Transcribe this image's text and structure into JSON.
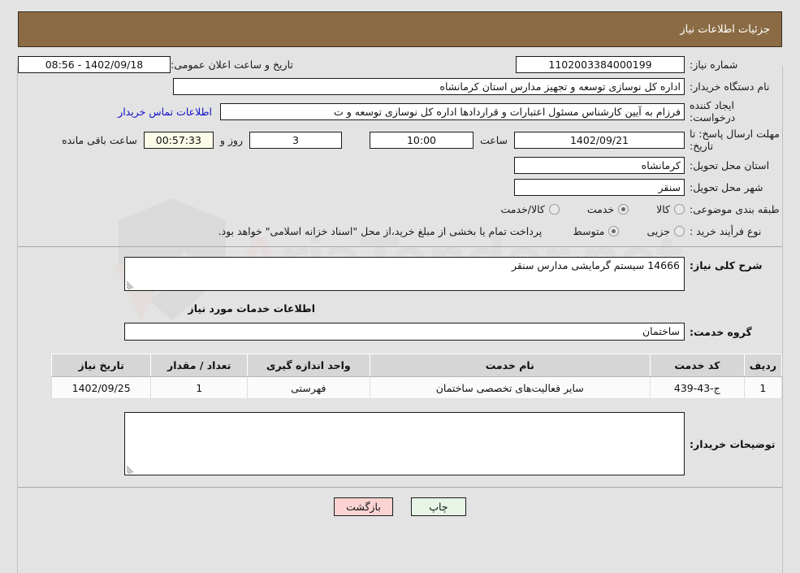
{
  "header": {
    "title": "جزئیات اطلاعات نیاز"
  },
  "form": {
    "need_number": {
      "label": "شماره نیاز:",
      "value": "1102003384000199"
    },
    "public_announce": {
      "label": "تاریخ و ساعت اعلان عمومی:",
      "value": "1402/09/18 - 08:56"
    },
    "buyer_org": {
      "label": "نام دستگاه خریدار:",
      "value": "اداره کل نوسازی  توسعه و تجهیز مدارس استان کرمانشاه"
    },
    "request_creator": {
      "label": "ایجاد کننده درخواست:",
      "value": "فرزام به آیین کارشناس مسئول اعتبارات و قراردادها اداره کل نوسازی  توسعه و ت",
      "contact_link": "اطلاعات تماس خریدار"
    },
    "deadline": {
      "label": "مهلت ارسال پاسخ: تا تاریخ:",
      "date": "1402/09/21",
      "hour_label": "ساعت",
      "hour": "10:00",
      "days": "3",
      "days_label": "روز و",
      "timer": "00:57:33",
      "remaining_label": "ساعت باقی مانده"
    },
    "delivery_province": {
      "label": "استان محل تحویل:",
      "value": "کرمانشاه"
    },
    "delivery_city": {
      "label": "شهر محل تحویل:",
      "value": "سنقر"
    },
    "category": {
      "label": "طبقه بندی موضوعی:",
      "options": [
        {
          "label": "کالا",
          "selected": false
        },
        {
          "label": "خدمت",
          "selected": true
        },
        {
          "label": "کالا/خدمت",
          "selected": false
        }
      ]
    },
    "purchase_type": {
      "label": "نوع فرأیند خرید :",
      "options": [
        {
          "label": "جزیی",
          "selected": false
        },
        {
          "label": "متوسط",
          "selected": true
        }
      ],
      "note": "پرداخت تمام یا بخشی از مبلغ خرید،از محل \"اسناد خزانه اسلامی\" خواهد بود."
    }
  },
  "description": {
    "label": "شرح کلی نیاز:",
    "value": "14666 سیستم گرمایشی مدارس سنقر"
  },
  "services": {
    "section_title": "اطلاعات خدمات مورد نیاز",
    "group_label": "گروه خدمت:",
    "group_value": "ساختمان",
    "columns": [
      "ردیف",
      "کد خدمت",
      "نام خدمت",
      "واحد اندازه گیری",
      "تعداد / مقدار",
      "تاریخ نیاز"
    ],
    "rows": [
      {
        "radif": "1",
        "code": "ج-43-439",
        "name": "سایر فعالیت‌های تخصصی ساختمان",
        "unit": "فهرستی",
        "qty": "1",
        "date": "1402/09/25"
      }
    ]
  },
  "buyer_notes": {
    "label": "توضیحات خریدار:",
    "value": ""
  },
  "buttons": {
    "print": "چاپ",
    "back": "بازگشت"
  },
  "watermark": {
    "text_a": "A",
    "text_rest": "riaTender.net"
  },
  "colors": {
    "header_bg": "#8b6b44",
    "link": "#1111cc",
    "timer_bg": "#fbfbe8",
    "print_bg": "#e6f5e6",
    "back_bg": "#fbd3d3"
  }
}
